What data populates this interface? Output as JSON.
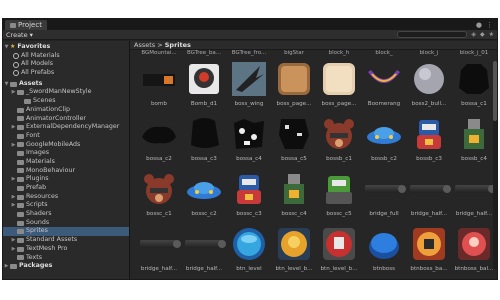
{
  "window": {
    "tab_title": "Project",
    "create_label": "Create"
  },
  "sidebar": {
    "favorites": "Favorites",
    "fav_items": [
      "All Materials",
      "All Models",
      "All Prefabs"
    ],
    "assets": "Assets",
    "items": [
      {
        "label": "_SwordManNewStyle",
        "indent": 1,
        "arrow": true
      },
      {
        "label": "Scenes",
        "indent": 2
      },
      {
        "label": "AnimationClip",
        "indent": 1
      },
      {
        "label": "AnimatorController",
        "indent": 1
      },
      {
        "label": "ExternalDependencyManager",
        "indent": 1,
        "arrow": true
      },
      {
        "label": "Font",
        "indent": 1
      },
      {
        "label": "GoogleMobileAds",
        "indent": 1,
        "arrow": true
      },
      {
        "label": "Images",
        "indent": 1
      },
      {
        "label": "Materials",
        "indent": 1
      },
      {
        "label": "MonoBehaviour",
        "indent": 1
      },
      {
        "label": "Plugins",
        "indent": 1,
        "arrow": true
      },
      {
        "label": "Prefab",
        "indent": 1
      },
      {
        "label": "Resources",
        "indent": 1,
        "arrow": true
      },
      {
        "label": "Scripts",
        "indent": 1,
        "arrow": true
      },
      {
        "label": "Shaders",
        "indent": 1
      },
      {
        "label": "Sounds",
        "indent": 1
      },
      {
        "label": "Sprites",
        "indent": 1,
        "selected": true
      },
      {
        "label": "Standard Assets",
        "indent": 1,
        "arrow": true
      },
      {
        "label": "TextMesh Pro",
        "indent": 1,
        "arrow": true
      },
      {
        "label": "Texts",
        "indent": 1
      }
    ],
    "packages": "Packages"
  },
  "breadcrumb": {
    "root": "Assets",
    "sep": " > ",
    "current": "Sprites"
  },
  "top_labels": [
    "BGMountai...",
    "BGTree_ba...",
    "BGTree_fro...",
    "bigStar",
    "block_h",
    "block_",
    "block_j",
    "block_j_01"
  ],
  "assets": [
    {
      "label": "bomb",
      "kind": "bomb"
    },
    {
      "label": "Bomb_d1",
      "kind": "bombd"
    },
    {
      "label": "boss_wing",
      "kind": "wing"
    },
    {
      "label": "boss_page...",
      "kind": "page"
    },
    {
      "label": "boss_page...",
      "kind": "page2"
    },
    {
      "label": "Boomerang",
      "kind": "boomer"
    },
    {
      "label": "boss2_bull...",
      "kind": "bullet"
    },
    {
      "label": "bossa_c1",
      "kind": "blob"
    },
    {
      "label": "bossa_c2",
      "kind": "blob2"
    },
    {
      "label": "bossa_c3",
      "kind": "blob3"
    },
    {
      "label": "bossa_c4",
      "kind": "blob4"
    },
    {
      "label": "bossa_c5",
      "kind": "blob5"
    },
    {
      "label": "bossb_c1",
      "kind": "bear"
    },
    {
      "label": "bossb_c2",
      "kind": "ufo"
    },
    {
      "label": "bossb_c3",
      "kind": "robot"
    },
    {
      "label": "bossb_c4",
      "kind": "tower"
    },
    {
      "label": "bossc_c1",
      "kind": "bear"
    },
    {
      "label": "bossc_c2",
      "kind": "ufo"
    },
    {
      "label": "bossc_c3",
      "kind": "robot"
    },
    {
      "label": "bossc_c4",
      "kind": "tower"
    },
    {
      "label": "bossc_c5",
      "kind": "green"
    },
    {
      "label": "bridge_full",
      "kind": "bridge"
    },
    {
      "label": "bridge_half...",
      "kind": "bridge"
    },
    {
      "label": "bridge_half...",
      "kind": "bridge"
    },
    {
      "label": "bridge_half...",
      "kind": "bridge"
    },
    {
      "label": "bridge_half...",
      "kind": "bridge"
    },
    {
      "label": "btn_level",
      "kind": "btnblue"
    },
    {
      "label": "btn_level_b...",
      "kind": "btnorange"
    },
    {
      "label": "btn_level_b...",
      "kind": "btnred"
    },
    {
      "label": "btnboss",
      "kind": "btnblue2"
    },
    {
      "label": "btnboss_ba...",
      "kind": "btnboss2"
    },
    {
      "label": "btnboss_bal...",
      "kind": "btnboss3"
    }
  ]
}
